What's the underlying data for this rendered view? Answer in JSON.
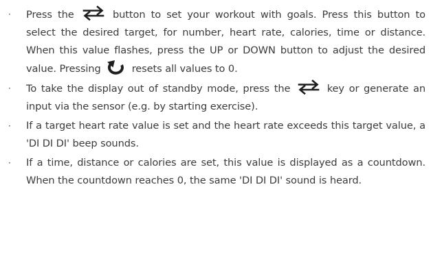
{
  "items": [
    {
      "parts": [
        "Press the",
        "button to set your workout with goals. Press this button to select the desired target, for number, heart rate, calories, time or distance. When this value flashes, press the UP or DOWN button to adjust the desired value. Pressing",
        "resets all values to 0."
      ],
      "icons": [
        "swap-arrows-icon",
        "reset-arrow-icon"
      ]
    },
    {
      "parts": [
        "To take the display out of standby mode, press the",
        "key or generate an input via the sensor (e.g. by starting exercise)."
      ],
      "icons": [
        "swap-arrows-icon"
      ]
    },
    {
      "parts": [
        "If a target heart rate value is set and the heart rate exceeds this target value, a 'DI DI DI' beep sounds."
      ]
    },
    {
      "parts": [
        "If a time, distance or calories are set, this value is displayed as a countdown. When the countdown reaches 0, the same 'DI DI DI' sound is heard."
      ]
    }
  ],
  "bullet_char": "·",
  "colors": {
    "text": "#3b3b3b",
    "icon": "#1e1e1e"
  }
}
